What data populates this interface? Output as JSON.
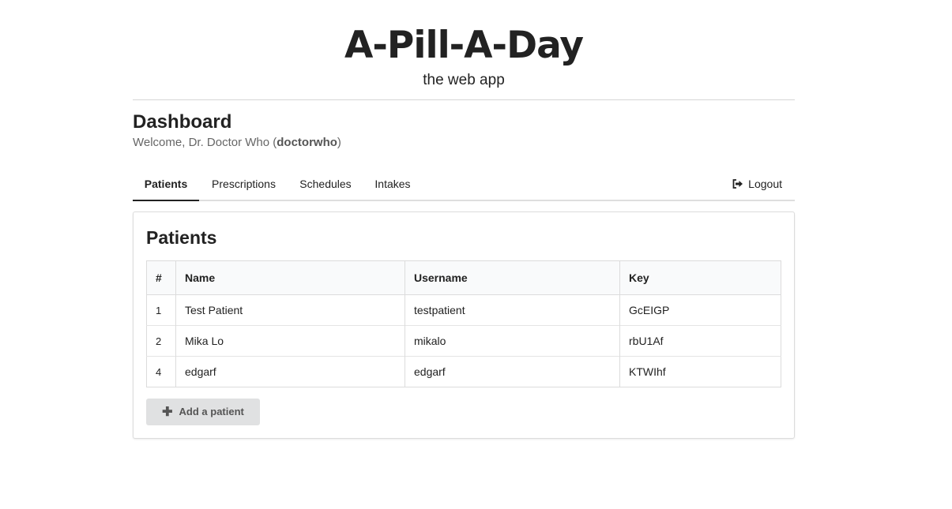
{
  "app": {
    "title": "A-Pill-A-Day",
    "subtitle": "the web app"
  },
  "dashboard": {
    "title": "Dashboard",
    "welcome_prefix": "Welcome, Dr. Doctor Who (",
    "username": "doctorwho",
    "welcome_suffix": ")"
  },
  "tabs": [
    {
      "label": "Patients",
      "active": true
    },
    {
      "label": "Prescriptions",
      "active": false
    },
    {
      "label": "Schedules",
      "active": false
    },
    {
      "label": "Intakes",
      "active": false
    }
  ],
  "logout": {
    "label": "Logout",
    "icon": "sign-out-icon"
  },
  "patients": {
    "title": "Patients",
    "columns": [
      "#",
      "Name",
      "Username",
      "Key"
    ],
    "rows": [
      {
        "num": "1",
        "name": "Test Patient",
        "username": "testpatient",
        "key": "GcEIGP"
      },
      {
        "num": "2",
        "name": "Mika Lo",
        "username": "mikalo",
        "key": "rbU1Af"
      },
      {
        "num": "4",
        "name": "edgarf",
        "username": "edgarf",
        "key": "KTWIhf"
      }
    ],
    "add_button": {
      "label": "Add a patient",
      "icon": "plus-icon"
    }
  }
}
